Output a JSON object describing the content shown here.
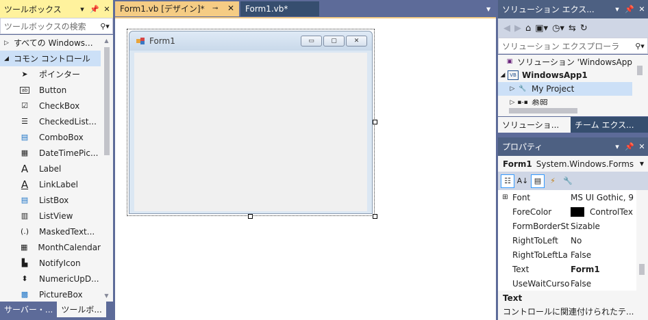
{
  "toolbox": {
    "title": "ツールボックス",
    "search_placeholder": "ツールボックスの検索",
    "categories": [
      {
        "label": "すべての Windows...",
        "expanded": false
      },
      {
        "label": "コモン コントロール",
        "expanded": true
      }
    ],
    "items": [
      {
        "label": "ポインター",
        "icon": "pointer-icon"
      },
      {
        "label": "Button",
        "icon": "button-control-icon"
      },
      {
        "label": "CheckBox",
        "icon": "checkbox-control-icon"
      },
      {
        "label": "CheckedList...",
        "icon": "checkedlistbox-icon"
      },
      {
        "label": "ComboBox",
        "icon": "combobox-icon"
      },
      {
        "label": "DateTimePic...",
        "icon": "datetimepicker-icon"
      },
      {
        "label": "Label",
        "icon": "label-icon"
      },
      {
        "label": "LinkLabel",
        "icon": "linklabel-icon"
      },
      {
        "label": "ListBox",
        "icon": "listbox-icon"
      },
      {
        "label": "ListView",
        "icon": "listview-icon"
      },
      {
        "label": "MaskedText...",
        "icon": "maskedtextbox-icon"
      },
      {
        "label": "MonthCalendar",
        "icon": "monthcalendar-icon"
      },
      {
        "label": "NotifyIcon",
        "icon": "notifyicon-icon"
      },
      {
        "label": "NumericUpD...",
        "icon": "numericupdown-icon"
      },
      {
        "label": "PictureBox",
        "icon": "picturebox-icon"
      }
    ],
    "bottom_tabs": [
      "サーバー・...",
      "ツールボ..."
    ]
  },
  "document_tabs": [
    {
      "label": "Form1.vb [デザイン]*",
      "active": true
    },
    {
      "label": "Form1.vb*",
      "active": false
    }
  ],
  "designer": {
    "form_title": "Form1"
  },
  "solution_explorer": {
    "title": "ソリューション エクス...",
    "search_placeholder": "ソリューション エクスプローラ",
    "nodes": [
      {
        "label": "ソリューション 'WindowsApp",
        "icon": "solution-icon",
        "bold": false
      },
      {
        "label": "WindowsApp1",
        "icon": "vb-project-icon",
        "bold": true
      },
      {
        "label": "My Project",
        "icon": "wrench-icon",
        "bold": false
      },
      {
        "label": "参照",
        "icon": "references-icon",
        "bold": false
      }
    ],
    "tabs": [
      "ソリューショ...",
      "チーム エクス..."
    ]
  },
  "properties": {
    "title": "プロパティ",
    "object_name": "Form1",
    "object_type": "System.Windows.Forms",
    "rows": [
      {
        "name": "Font",
        "value": "MS UI Gothic, 9",
        "expandable": true,
        "bold": false
      },
      {
        "name": "ForeColor",
        "value": "ControlTex",
        "swatch": "#000000",
        "bold": false
      },
      {
        "name": "FormBorderSt",
        "value": "Sizable",
        "bold": false
      },
      {
        "name": "RightToLeft",
        "value": "No",
        "bold": false
      },
      {
        "name": "RightToLeftLa",
        "value": "False",
        "bold": false
      },
      {
        "name": "Text",
        "value": "Form1",
        "bold": true
      },
      {
        "name": "UseWaitCurso",
        "value": "False",
        "bold": false
      }
    ],
    "description_title": "Text",
    "description_text": "コントロールに関連付けられたテ..."
  },
  "colors": {
    "chrome": "#5d6b99",
    "active_tab": "#f5cc84",
    "toolwindow_active_title": "#fff29d",
    "selection": "#cce0f7"
  }
}
